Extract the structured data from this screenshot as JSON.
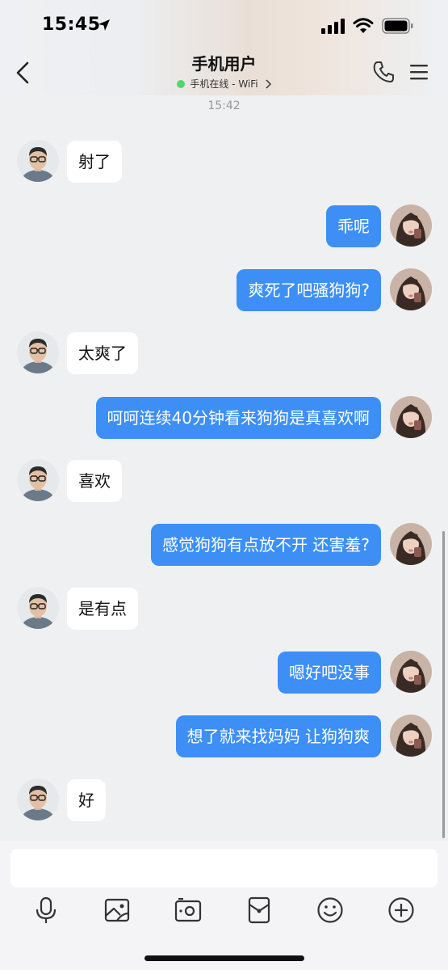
{
  "status_bar": {
    "time": "15:45"
  },
  "header": {
    "title": "手机用户",
    "subtitle": "手机在线 - WiFi"
  },
  "timestamp": "15:42",
  "messages": [
    {
      "from": "contact",
      "text": "射了"
    },
    {
      "from": "me",
      "text": "乖呢"
    },
    {
      "from": "me",
      "text": "爽死了吧骚狗狗?"
    },
    {
      "from": "contact",
      "text": "太爽了"
    },
    {
      "from": "me",
      "text": "呵呵连续40分钟看来狗狗是真喜欢啊"
    },
    {
      "from": "contact",
      "text": "喜欢"
    },
    {
      "from": "me",
      "text": "感觉狗狗有点放不开 还害羞?"
    },
    {
      "from": "contact",
      "text": "是有点"
    },
    {
      "from": "me",
      "text": "嗯好吧没事"
    },
    {
      "from": "me",
      "text": "想了就来找妈妈 让狗狗爽"
    },
    {
      "from": "contact",
      "text": "好"
    }
  ],
  "input": {
    "value": "",
    "placeholder": ""
  },
  "toolbar": [
    "mic-icon",
    "image-icon",
    "camera-icon",
    "red-packet-icon",
    "emoji-icon",
    "plus-icon"
  ],
  "colors": {
    "outgoing_bubble": "#3d8ff5",
    "incoming_bubble": "#ffffff",
    "online_dot": "#4fd96e"
  }
}
